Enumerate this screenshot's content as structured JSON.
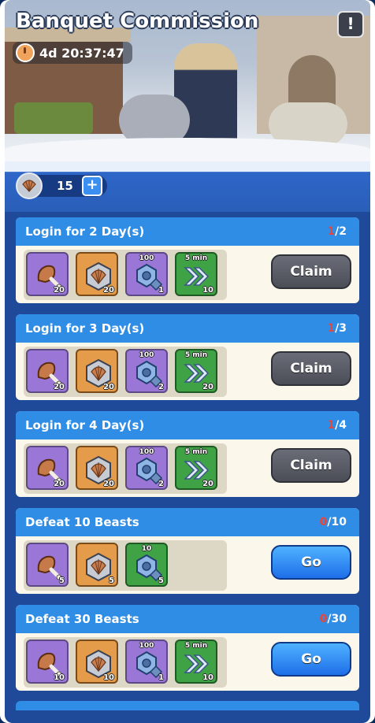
{
  "header": {
    "title": "Banquet Commission",
    "timer": "4d 20:37:47",
    "info_label": "!"
  },
  "currency": {
    "amount": "15",
    "plus_label": "+"
  },
  "tasks": [
    {
      "title": "Login for 2 Day(s)",
      "progress_current": "1",
      "progress_total": "/2",
      "button": "Claim",
      "button_style": "claim",
      "rewards": [
        {
          "icon": "meat-icon",
          "color": "purple",
          "count": "20",
          "top": ""
        },
        {
          "icon": "shell-coin-icon",
          "color": "orange",
          "count": "20",
          "top": ""
        },
        {
          "icon": "hex-nut-icon",
          "color": "purple",
          "count": "1",
          "top": "100"
        },
        {
          "icon": "speedup-icon",
          "color": "green",
          "count": "10",
          "top": "5 min"
        }
      ]
    },
    {
      "title": "Login for 3 Day(s)",
      "progress_current": "1",
      "progress_total": "/3",
      "button": "Claim",
      "button_style": "claim",
      "rewards": [
        {
          "icon": "meat-icon",
          "color": "purple",
          "count": "20",
          "top": ""
        },
        {
          "icon": "shell-coin-icon",
          "color": "orange",
          "count": "20",
          "top": ""
        },
        {
          "icon": "hex-nut-icon",
          "color": "purple",
          "count": "2",
          "top": "100"
        },
        {
          "icon": "speedup-icon",
          "color": "green",
          "count": "20",
          "top": "5 min"
        }
      ]
    },
    {
      "title": "Login for 4 Day(s)",
      "progress_current": "1",
      "progress_total": "/4",
      "button": "Claim",
      "button_style": "claim",
      "rewards": [
        {
          "icon": "meat-icon",
          "color": "purple",
          "count": "20",
          "top": ""
        },
        {
          "icon": "shell-coin-icon",
          "color": "orange",
          "count": "20",
          "top": ""
        },
        {
          "icon": "hex-nut-icon",
          "color": "purple",
          "count": "2",
          "top": "100"
        },
        {
          "icon": "speedup-icon",
          "color": "green",
          "count": "20",
          "top": "5 min"
        }
      ]
    },
    {
      "title": "Defeat 10 Beasts",
      "progress_current": "0",
      "progress_total": "/10",
      "button": "Go",
      "button_style": "go",
      "rewards": [
        {
          "icon": "meat-icon",
          "color": "purple",
          "count": "5",
          "top": ""
        },
        {
          "icon": "shell-coin-icon",
          "color": "orange",
          "count": "5",
          "top": ""
        },
        {
          "icon": "hex-nut-icon",
          "color": "green",
          "count": "5",
          "top": "10"
        }
      ]
    },
    {
      "title": "Defeat 30 Beasts",
      "progress_current": "0",
      "progress_total": "/30",
      "button": "Go",
      "button_style": "go",
      "rewards": [
        {
          "icon": "meat-icon",
          "color": "purple",
          "count": "10",
          "top": ""
        },
        {
          "icon": "shell-coin-icon",
          "color": "orange",
          "count": "10",
          "top": ""
        },
        {
          "icon": "hex-nut-icon",
          "color": "purple",
          "count": "1",
          "top": "100"
        },
        {
          "icon": "speedup-icon",
          "color": "green",
          "count": "10",
          "top": "5 min"
        }
      ]
    }
  ]
}
